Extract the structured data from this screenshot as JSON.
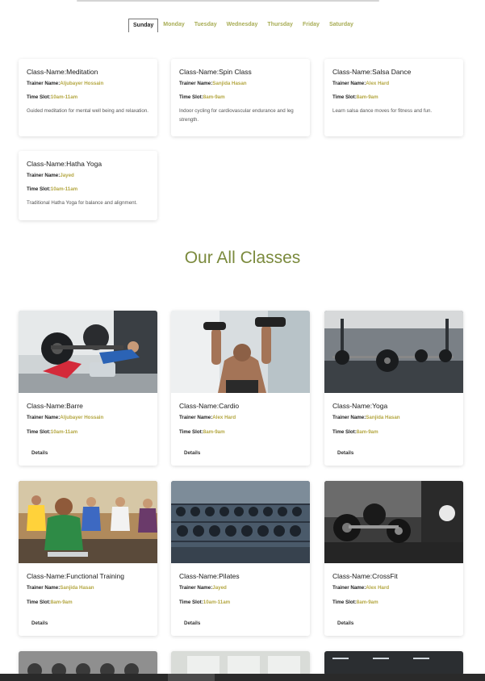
{
  "tabs": [
    "Sunday",
    "Monday",
    "Tuesday",
    "Wednesday",
    "Thursday",
    "Friday",
    "Saturday"
  ],
  "active_tab": "Sunday",
  "labels": {
    "class_name": "Class-Name:",
    "trainer_name": "Trainer Name:",
    "time_slot": "Time Slot:",
    "details": "Details"
  },
  "schedule": [
    {
      "class": "Meditation",
      "trainer": "Aljubayer Hossain",
      "time": "10am-11am",
      "description": "Guided meditation for mental well being and relaxation."
    },
    {
      "class": "Spin Class",
      "trainer": "Sanjida Hasan",
      "time": "8am-9am",
      "description": "Indoor cycling for cardiovascular endurance and leg strength."
    },
    {
      "class": "Salsa Dance",
      "trainer": "Alex Hard",
      "time": "8am-9am",
      "description": "Learn salsa dance moves for fitness and fun."
    },
    {
      "class": "Hatha Yoga",
      "trainer": "Jayed",
      "time": "10am-11am",
      "description": "Traditional Hatha Yoga for balance and alignment."
    }
  ],
  "section_title": "Our All Classes",
  "classes": [
    {
      "class": "Barre",
      "trainer": "Aljubayer Hossain",
      "time": "10am-11am",
      "image": "barre-workout-photo"
    },
    {
      "class": "Cardio",
      "trainer": "Alex Hard",
      "time": "8am-9am",
      "image": "dumbbell-press-photo"
    },
    {
      "class": "Yoga",
      "trainer": "Sanjida Hasan",
      "time": "8am-9am",
      "image": "gym-barbells-photo"
    },
    {
      "class": "Functional Training",
      "trainer": "Sanjida Hasan",
      "time": "8am-9am",
      "image": "spin-class-photo"
    },
    {
      "class": "Pilates",
      "trainer": "Jayed",
      "time": "10am-11am",
      "image": "dumbbell-rack-photo"
    },
    {
      "class": "CrossFit",
      "trainer": "Alex Hard",
      "time": "8am-9am",
      "image": "dumbbells-floor-photo"
    }
  ],
  "colors": {
    "accent": "#b4a742",
    "title": "#7b8a3d"
  }
}
